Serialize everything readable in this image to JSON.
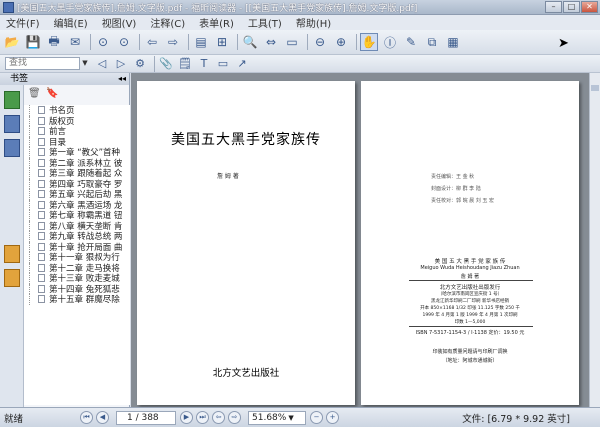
{
  "window": {
    "title": "[美国五大黑手党家族传].詹姆.文字版.pdf - 福昕阅读器 - [[美国五大黑手党家族传].詹姆.文字版.pdf]"
  },
  "menu": [
    "文件(F)",
    "编辑(E)",
    "视图(V)",
    "注释(C)",
    "表单(R)",
    "工具(T)",
    "帮助(H)"
  ],
  "toolbar": {
    "search_placeholder": "查找"
  },
  "panel": {
    "title": "书签",
    "bookmarks": [
      "书名页",
      "版权页",
      "前言",
      "目录",
      "第一章 “教父”首种",
      "第二章 派系林立 彼",
      "第三章 跟随着起 众",
      "第四章 巧取豪夺 罗",
      "第五章 兴起后劫 黑",
      "第六章 黑酒运场 龙",
      "第七章 称霸黑道 钮",
      "第八章 横天垄断 肯",
      "第九章 转战总统 两",
      "第十章 抢开局面 曲",
      "第十一章 狠叔为行",
      "第十二章 走马换将",
      "第十三章 败走麦城",
      "第十四章 兔死狐悲",
      "第十五章 群魔尽除"
    ]
  },
  "page1": {
    "title": "美国五大黑手党家族传",
    "author": "詹 姆 著",
    "publisher": "北方文艺出版社"
  },
  "page2": {
    "editor": "责任编辑：王 金 秋",
    "designer": "封面设计：柳 群  李 陆",
    "proof": "责任校对：郭 皖 晨   刘 玉 宏",
    "book_title": "美 国 五 大 黑 手 党 家 族 传",
    "pinyin": "Meiguo Wuda Heishoudang Jiazu Zhuan",
    "author": "詹 姆 著",
    "publisher": "北方文艺出版社出版发行",
    "address": "（哈尔滨市南岗区宣庆街 1 号）",
    "printer": "黑龙江新华印刷二厂印刷  新华书店经销",
    "spec": "开本 850×1168 1/32  印张 11.125  字数 250 千",
    "edition": "1999 年 4 月第 1 版  1999 年 4 月第 1 次印刷",
    "copies": "印数 1—5,000",
    "isbn": "ISBN 7-5317-1154-3 / I·1138  定价：19.50 元",
    "notice": "印装如有质量问题请与印刷厂调换",
    "notice_addr": "（地址：阿城市通城街）"
  },
  "status": {
    "ready": "就绪",
    "page": "1 / 388",
    "zoom": "51.68%",
    "size": "文件: [6.79 * 9.92 英寸]"
  }
}
